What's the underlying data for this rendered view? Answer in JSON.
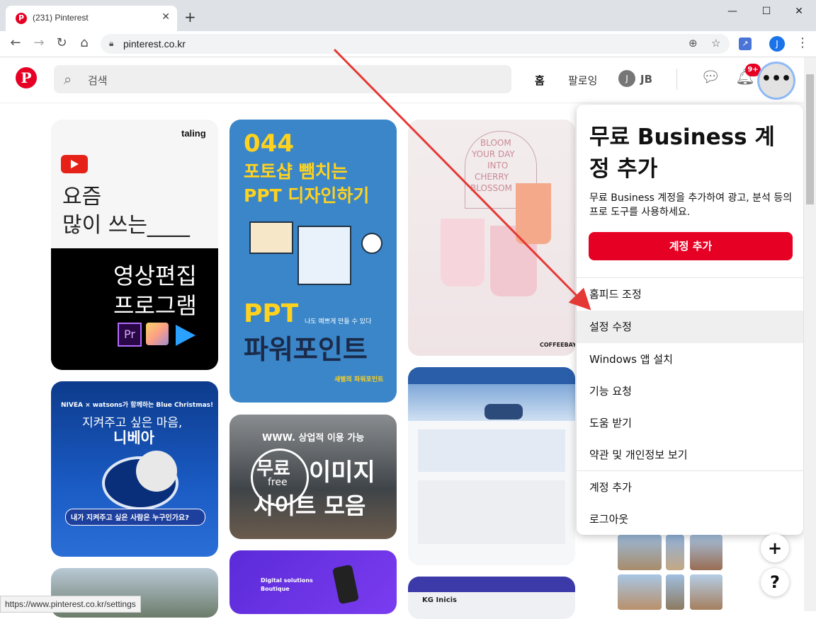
{
  "browser": {
    "tab_title": "(231) Pinterest",
    "url": "pinterest.co.kr",
    "profile_initial": "J",
    "status_url": "https://www.pinterest.co.kr/settings"
  },
  "header": {
    "logo": "P",
    "search_placeholder": "검색",
    "nav_home": "홈",
    "nav_following": "팔로잉",
    "avatar_initial": "J",
    "username": "JB",
    "notification_badge": "9+",
    "more_label": "•••"
  },
  "pins": {
    "p1": {
      "brand": "taling",
      "line1": "요즘",
      "line2": "많이 쓰는____",
      "line3": "영상편집",
      "line4": "프로그램"
    },
    "p2": {
      "num": "044",
      "line1": "포토샵 뺌치는",
      "line2": "PPT 디자인하기",
      "line3": "PPT",
      "line4": "나도 예쁘게 만들 수 있다",
      "line5": "파워포인트",
      "line6": "새별의 파워포인트"
    },
    "p3": {
      "line1": "BLOOM",
      "line2": "YOUR DAY",
      "line3": "INTO",
      "line4": "CHERRY",
      "line5": "BLOSSOM",
      "brand": "COFFEEBAY"
    },
    "p4": {
      "line1": "NIVEA × watsons가 함께하는 Blue Christmas!",
      "line2": "지켜주고 싶은 마음,",
      "line3": "니베아",
      "line4": "내가 지켜주고 싶은 사람은 누구인가요?"
    },
    "p5": {
      "line1": "WWW. 상업적 이용 가능",
      "line2": "무료",
      "line3": "free",
      "line4": "이미지",
      "line5": "사이트 모음"
    },
    "p7": {
      "line1": "Digital solutions",
      "line2": "Boutique"
    },
    "p8": {
      "line1": "KG Inicis"
    }
  },
  "dropdown": {
    "title": "무료 Business 계정 추가",
    "description": "무료 Business 계정을 추가하여 광고, 분석 등의 프로 도구를 사용하세요.",
    "cta": "계정 추가",
    "items": [
      {
        "label": "홈피드 조정"
      },
      {
        "label": "설정 수정"
      },
      {
        "label": "Windows 앱 설치"
      },
      {
        "label": "기능 요청"
      },
      {
        "label": "도움 받기"
      },
      {
        "label": "약관 및 개인정보 보기"
      },
      {
        "label": "계정 추가"
      },
      {
        "label": "로그아웃"
      }
    ]
  },
  "floating": {
    "add": "+",
    "help": "?"
  },
  "colors": {
    "brand": "#e60023",
    "active_item": "#efefef",
    "annotation_arrow": "#e53935"
  }
}
